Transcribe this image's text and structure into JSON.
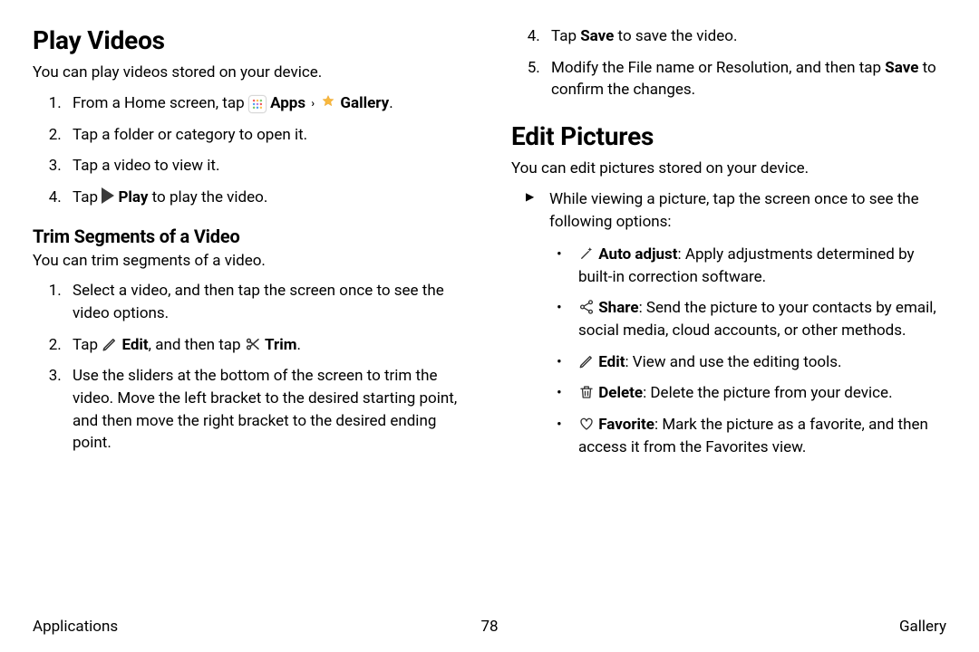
{
  "left": {
    "h1": "Play Videos",
    "intro": "You can play videos stored on your device.",
    "step1_a": "From a Home screen, tap ",
    "step1_b": "Apps",
    "step1_c": "Gallery",
    "step1_dot": ".",
    "step2": "Tap a folder or category to open it.",
    "step3": "Tap a video to view it.",
    "step4_a": "Tap ",
    "step4_b": "Play",
    "step4_c": " to play the video.",
    "h2": "Trim Segments of a Video",
    "trim_intro": "You can trim segments of a video.",
    "trim1": "Select a video, and then tap the screen once to see the video options.",
    "trim2_a": "Tap ",
    "trim2_b": "Edit",
    "trim2_c": ", and then tap ",
    "trim2_d": "Trim",
    "trim2_e": ".",
    "trim3": "Use the sliders at the bottom of the screen to trim the video. Move the left bracket to the desired starting point, and then move the right bracket to the desired ending point."
  },
  "right": {
    "step4_a": "Tap ",
    "step4_b": "Save",
    "step4_c": " to save the video.",
    "step5_a": "Modify the File name or Resolution, and then tap ",
    "step5_b": "Save",
    "step5_c": " to confirm the changes.",
    "h1": "Edit Pictures",
    "intro": "You can edit pictures stored on your device.",
    "tri": "While viewing a picture, tap the screen once to see the following options:",
    "auto_b": "Auto adjust",
    "auto_t": ": Apply adjustments determined by built-in correction software.",
    "share_b": "Share",
    "share_t": ": Send the picture to your contacts by email, social media, cloud accounts, or other methods.",
    "edit_b": "Edit",
    "edit_t": ": View and use the editing tools.",
    "del_b": "Delete",
    "del_t": ": Delete the picture from your device.",
    "fav_b": "Favorite",
    "fav_t": ": Mark the picture as a favorite, and then access it from the Favorites view."
  },
  "footer": {
    "left": "Applications",
    "page": "78",
    "right": "Gallery"
  }
}
